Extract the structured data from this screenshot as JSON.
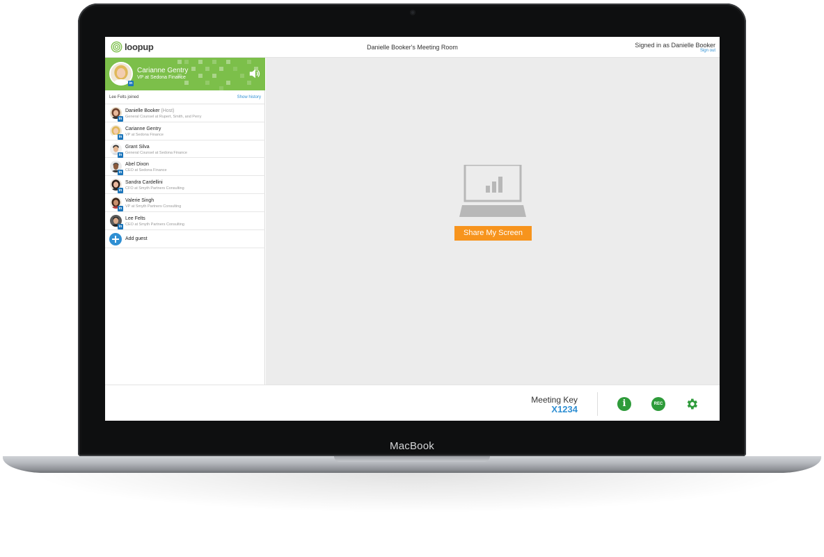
{
  "device": {
    "brand_label": "MacBook"
  },
  "app": {
    "logo_text": "loopup",
    "room_title": "Danielle Booker's Meeting Room",
    "signed_in_text": "Signed in as Danielle Booker",
    "sign_out_label": "Sign out"
  },
  "active_speaker": {
    "name": "Carianne Gentry",
    "role": "VP at Sedona Finance",
    "badge": "in"
  },
  "status": {
    "text": "Lee Felts joined",
    "show_history_label": "Show history"
  },
  "participants": [
    {
      "name": "Danielle Booker",
      "host_tag": "(Host)",
      "role": "General Counsel at Rupert, Smith, and Perry",
      "badge": "in"
    },
    {
      "name": "Carianne Gentry",
      "host_tag": "",
      "role": "VP at Sedona Finance",
      "badge": "in"
    },
    {
      "name": "Grant Silva",
      "host_tag": "",
      "role": "General Counsel at Sedona Finance",
      "badge": "in"
    },
    {
      "name": "Abel Dixon",
      "host_tag": "",
      "role": "CEO at Sedona Finance",
      "badge": "in"
    },
    {
      "name": "Sandra Cardellini",
      "host_tag": "",
      "role": "CFO at Smyth Partners Consulting",
      "badge": "in"
    },
    {
      "name": "Valerie Singh",
      "host_tag": "",
      "role": "VP at Smyth Partners Consulting",
      "badge": "in"
    },
    {
      "name": "Lee Felts",
      "host_tag": "",
      "role": "CEO at Smyth Partners Consulting",
      "badge": "in"
    }
  ],
  "add_guest_label": "Add guest",
  "stage": {
    "share_button_label": "Share My Screen"
  },
  "footer": {
    "meeting_key_label": "Meeting Key",
    "meeting_key_value": "X1234",
    "rec_label": "REC",
    "info_glyph": "i"
  },
  "colors": {
    "accent_green": "#7cbf4a",
    "button_green": "#2e9b3a",
    "accent_blue": "#2f8fd3",
    "share_orange": "#f7941d"
  },
  "icons": {
    "logo": "loopup-swirl-icon",
    "volume": "speaker-volume-icon",
    "linkedin": "linkedin-icon",
    "add": "plus-circle-icon",
    "info": "info-icon",
    "record": "record-icon",
    "settings": "gear-icon",
    "share": "laptop-chart-icon"
  }
}
